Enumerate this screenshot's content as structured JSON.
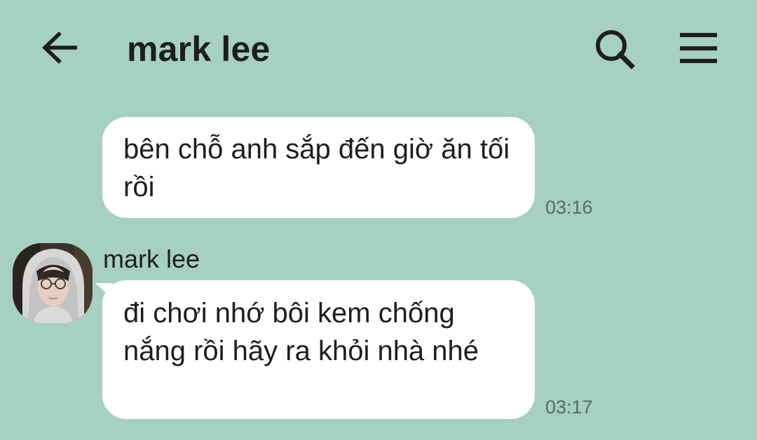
{
  "header": {
    "title": "mark lee",
    "back_icon": "arrow-left-icon",
    "search_icon": "search-icon",
    "menu_icon": "hamburger-menu-icon"
  },
  "messages": [
    {
      "direction": "outgoing",
      "text": "bên chỗ anh sắp đến giờ ăn tối rồi",
      "time": "03:16"
    },
    {
      "direction": "incoming",
      "sender": "mark lee",
      "text": "đi chơi nhớ bôi kem chống nắng rồi hãy ra khỏi nhà nhé",
      "time": "03:17"
    }
  ],
  "colors": {
    "background": "#a6d0c2",
    "bubble": "#ffffff",
    "text": "#1e1e1e",
    "timestamp": "#596b66"
  }
}
